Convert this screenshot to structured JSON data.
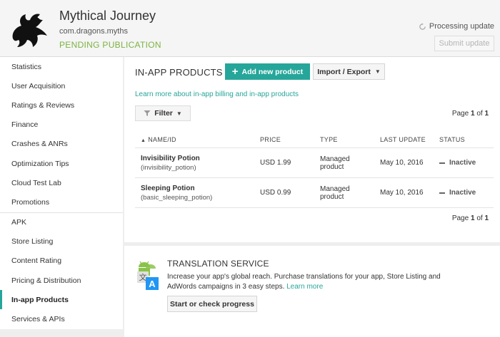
{
  "app": {
    "title": "Mythical Journey",
    "package": "com.dragons.myths",
    "status": "PENDING PUBLICATION",
    "processing": "Processing update",
    "submit_label": "Submit update"
  },
  "sidebar": {
    "group1": [
      {
        "label": "Statistics"
      },
      {
        "label": "User Acquisition"
      },
      {
        "label": "Ratings & Reviews"
      },
      {
        "label": "Finance"
      },
      {
        "label": "Crashes & ANRs"
      },
      {
        "label": "Optimization Tips"
      },
      {
        "label": "Cloud Test Lab"
      },
      {
        "label": "Promotions"
      }
    ],
    "group2": [
      {
        "label": "APK"
      },
      {
        "label": "Store Listing"
      },
      {
        "label": "Content Rating"
      },
      {
        "label": "Pricing & Distribution"
      },
      {
        "label": "In-app Products",
        "active": true
      },
      {
        "label": "Services & APIs"
      }
    ]
  },
  "main": {
    "title": "IN-APP PRODUCTS",
    "add_label": "Add new product",
    "import_label": "Import / Export",
    "learn_link": "Learn more about in-app billing and in-app products",
    "filter_label": "Filter",
    "page_word": "Page",
    "page_current": "1",
    "page_of": "of",
    "page_total": "1",
    "columns": {
      "name": "NAME/ID",
      "price": "PRICE",
      "type": "TYPE",
      "last_update": "LAST UPDATE",
      "status": "STATUS"
    },
    "products": [
      {
        "name": "Invisibility Potion",
        "id": "(invisibility_potion)",
        "price": "USD 1.99",
        "type_line1": "Managed",
        "type_line2": "product",
        "last_update": "May 10, 2016",
        "status": "Inactive"
      },
      {
        "name": "Sleeping Potion",
        "id": "(basic_sleeping_potion)",
        "price": "USD 0.99",
        "type_line1": "Managed",
        "type_line2": "product",
        "last_update": "May 10, 2016",
        "status": "Inactive"
      }
    ]
  },
  "translation": {
    "title": "TRANSLATION SERVICE",
    "text": "Increase your app's global reach. Purchase translations for your app, Store Listing and AdWords campaigns in 3 easy steps.",
    "link": "Learn more",
    "button": "Start or check progress"
  },
  "colors": {
    "accent": "#26a69a",
    "status_green": "#7cb342"
  },
  "icons": {
    "logo": "dragon-logo-icon",
    "processing": "sync-icon",
    "add": "plus-icon",
    "filter": "filter-funnel-icon",
    "translate": "android-translate-icon"
  }
}
